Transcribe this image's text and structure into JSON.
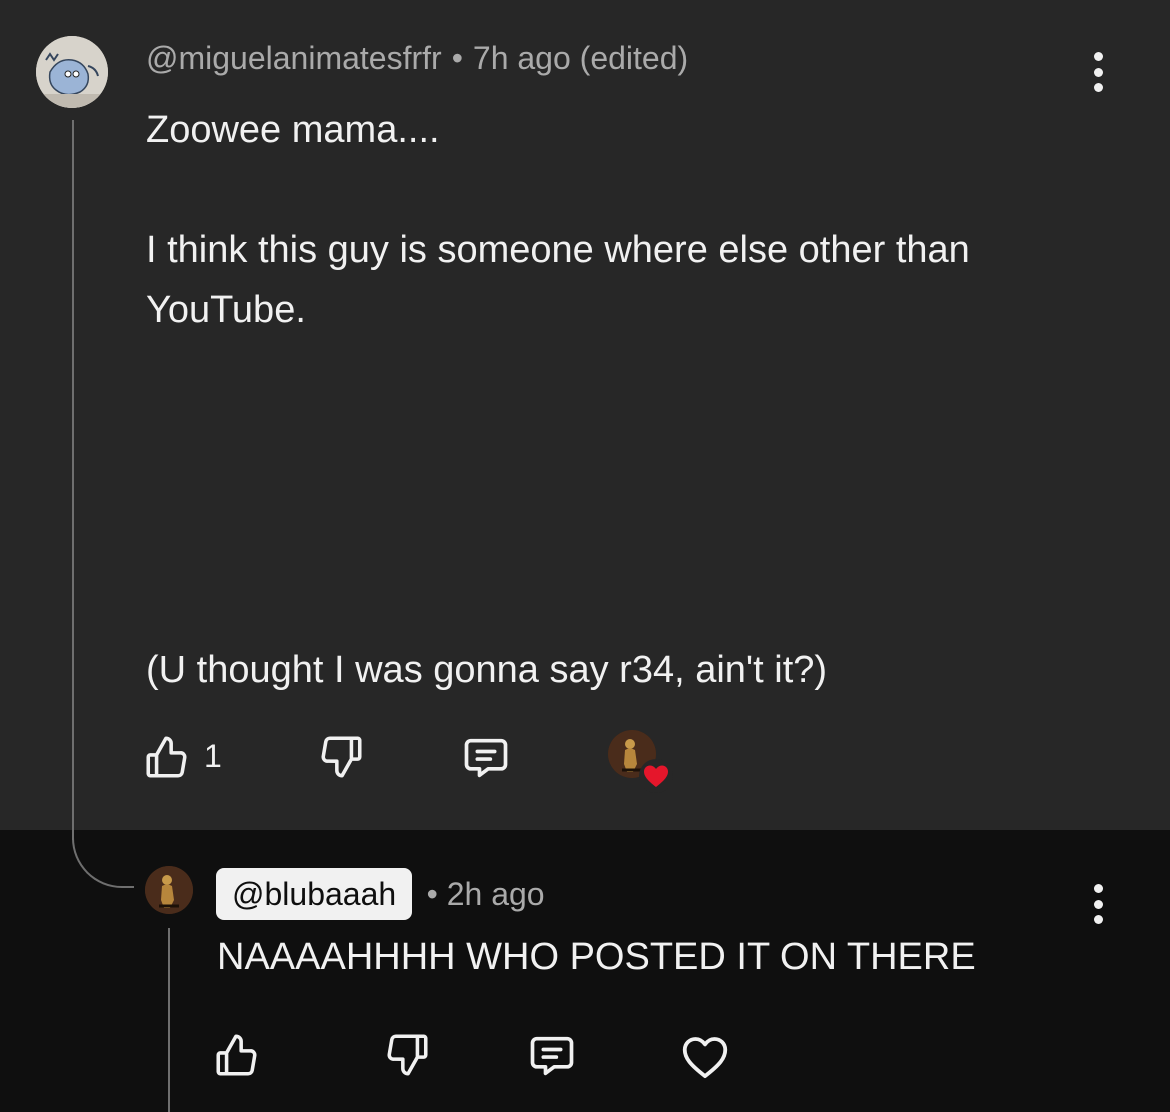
{
  "comment": {
    "handle": "@miguelanimatesfrfr",
    "separator": "•",
    "time": "7h ago (edited)",
    "lines": [
      "Zoowee mama....",
      "I think this guy is someone where else other than YouTube.",
      "(U thought I was gonna say r34, ain't it?)"
    ],
    "like_count": "1",
    "icons": {
      "like": "thumbs-up-icon",
      "dislike": "thumbs-down-icon",
      "reply": "comment-icon",
      "creator_heart": "heart-icon",
      "more": "more-vertical-icon"
    }
  },
  "reply": {
    "handle": "@blubaaah",
    "separator": "•",
    "time": "2h ago",
    "text": "NAAAAHHHH WHO POSTED IT ON THERE",
    "icons": {
      "like": "thumbs-up-icon",
      "dislike": "thumbs-down-icon",
      "reply": "comment-icon",
      "heart": "heart-outline-icon",
      "more": "more-vertical-icon"
    }
  },
  "colors": {
    "comment_background": "#272727",
    "reply_background": "#0f0f0f",
    "primary_text": "#f1f1f1",
    "secondary_text": "#aaaaaa",
    "heart": "#e5162b",
    "thread_line": "#6f6f6f"
  }
}
